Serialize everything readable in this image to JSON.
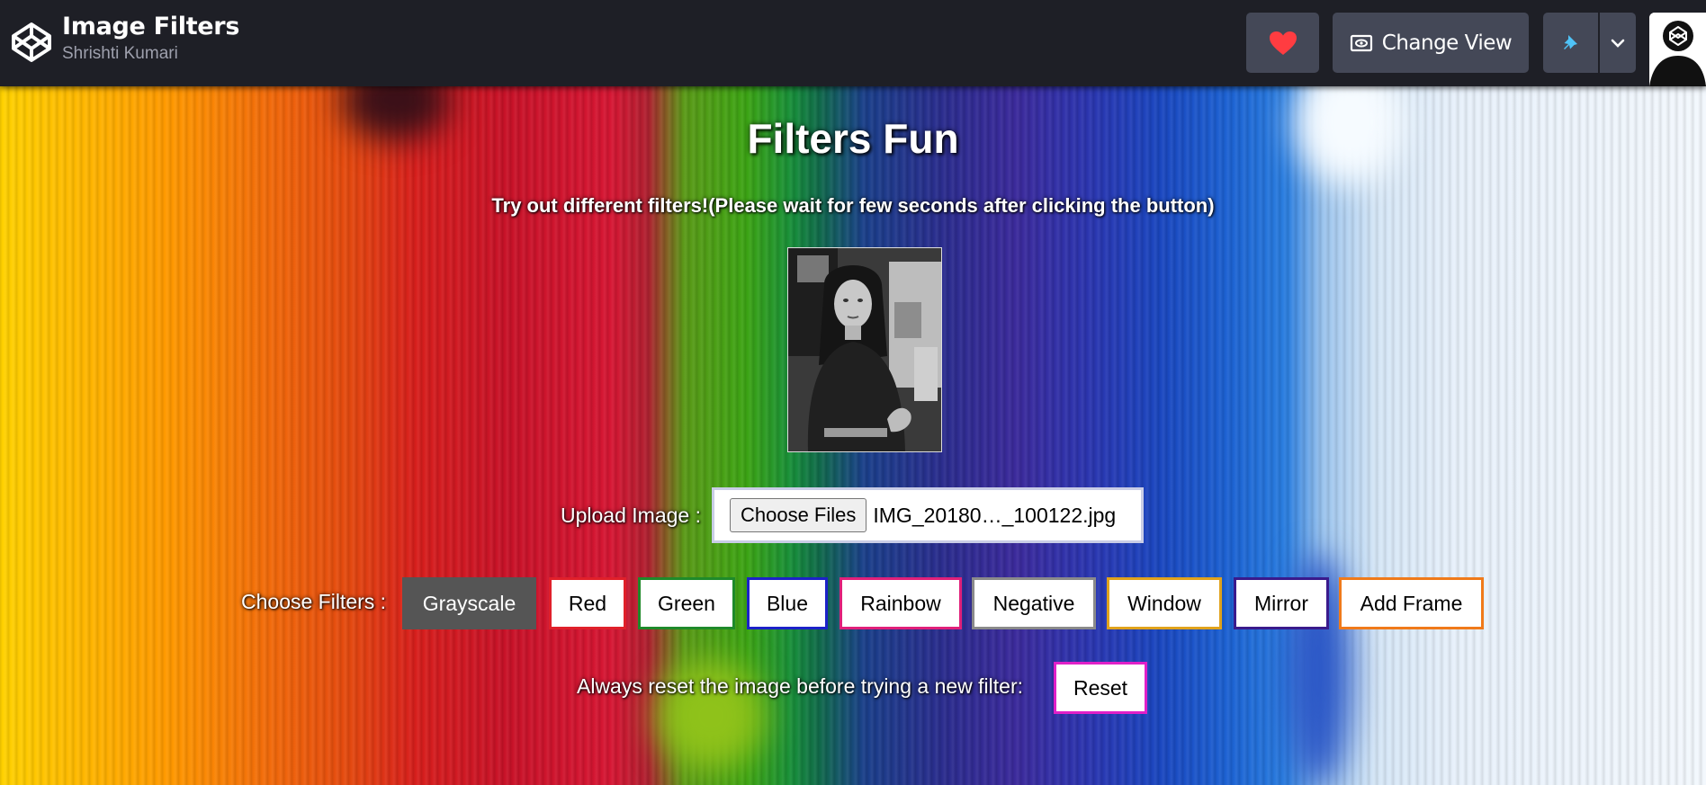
{
  "header": {
    "title": "Image Filters",
    "author": "Shrishti Kumari",
    "change_view_label": "Change View",
    "icons": [
      "codepen-logo-icon",
      "heart-icon",
      "eye-icon",
      "pin-icon",
      "chevron-down-icon"
    ]
  },
  "colors": {
    "topbar": "#1e1f26",
    "button_bg": "#444857",
    "heart": "#ff3c41",
    "pin": "#47cf73"
  },
  "main": {
    "heading": "Filters Fun",
    "subtitle": "Try out different filters!(Please wait for few seconds after clicking the button)",
    "upload_label": "Upload Image :",
    "file_button_label": "Choose Files",
    "file_name": "IMG_20180…_100122.jpg",
    "filters_label": "Choose Filters :",
    "filters": [
      {
        "label": "Grayscale",
        "border": "#555555",
        "bg": "#555555",
        "text": "#ffffff"
      },
      {
        "label": "Red",
        "border": "#e0202a",
        "bg": "#ffffff",
        "text": "#000000"
      },
      {
        "label": "Green",
        "border": "#1f8a2a",
        "bg": "#ffffff",
        "text": "#000000"
      },
      {
        "label": "Blue",
        "border": "#1c22c8",
        "bg": "#ffffff",
        "text": "#000000"
      },
      {
        "label": "Rainbow",
        "border": "#e0207a",
        "bg": "#ffffff",
        "text": "#000000"
      },
      {
        "label": "Negative",
        "border": "#8a8a8a",
        "bg": "#ffffff",
        "text": "#000000"
      },
      {
        "label": "Window",
        "border": "#e0a21c",
        "bg": "#ffffff",
        "text": "#000000"
      },
      {
        "label": "Mirror",
        "border": "#3a1a8c",
        "bg": "#ffffff",
        "text": "#000000"
      },
      {
        "label": "Add Frame",
        "border": "#f07a1a",
        "bg": "#ffffff",
        "text": "#000000"
      }
    ],
    "reset_hint": "Always reset the image before trying a new filter:",
    "reset_label": "Reset",
    "reset_border": "#e020c8"
  }
}
